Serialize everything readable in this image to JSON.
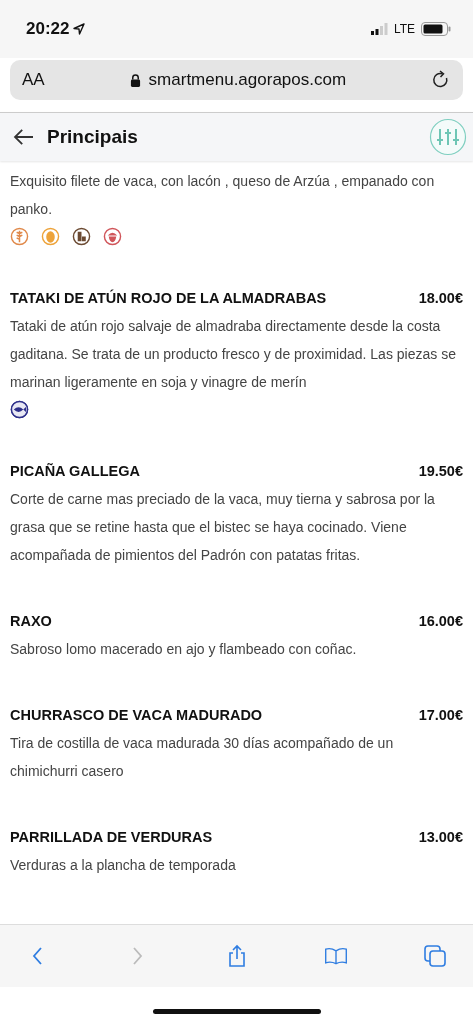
{
  "status_bar": {
    "time": "20:22",
    "network": "LTE"
  },
  "browser": {
    "text_size_button": "AA",
    "url": "smartmenu.agorapos.com"
  },
  "header": {
    "title": "Principais"
  },
  "partial_item": {
    "description": "Exquisito filete de vaca, con lacón , queso de Arzúa , empanado con panko.",
    "allergens": [
      {
        "kind": "gluten",
        "color": "#e0894a"
      },
      {
        "kind": "egg",
        "color": "#eda33a"
      },
      {
        "kind": "milk",
        "color": "#6b4a32"
      },
      {
        "kind": "nuts",
        "color": "#d0555a"
      }
    ]
  },
  "items": [
    {
      "name": "TATAKI DE ATÚN ROJO DE LA ALMADRABAS",
      "price": "18.00€",
      "description": "Tataki de atún rojo salvaje de almadraba directamente desde la costa gaditana. Se trata de un producto fresco y de proximidad. Las piezas se marinan ligeramente en soja y vinagre de merín",
      "allergens": [
        {
          "kind": "fish",
          "color": "#2d2f8a"
        }
      ]
    },
    {
      "name": "PICAÑA GALLEGA",
      "price": "19.50€",
      "description": "Corte de carne mas preciado de la vaca, muy tierna y sabrosa por la grasa que se retine hasta que el bistec se haya cocinado. Viene acompañada de pimientos del Padrón con patatas fritas."
    },
    {
      "name": "RAXO",
      "price": "16.00€",
      "description": "Sabroso lomo macerado en ajo y flambeado con coñac."
    },
    {
      "name": "CHURRASCO DE VACA MADURADO",
      "price": "17.00€",
      "description": "Tira de costilla de vaca madurada 30 días acompañado de un chimichurri casero"
    },
    {
      "name": "PARRILLADA DE VERDURAS",
      "price": "13.00€",
      "description": "Verduras a la plancha de temporada"
    }
  ],
  "toolbar": {
    "back_disabled": false,
    "forward_disabled": true
  }
}
